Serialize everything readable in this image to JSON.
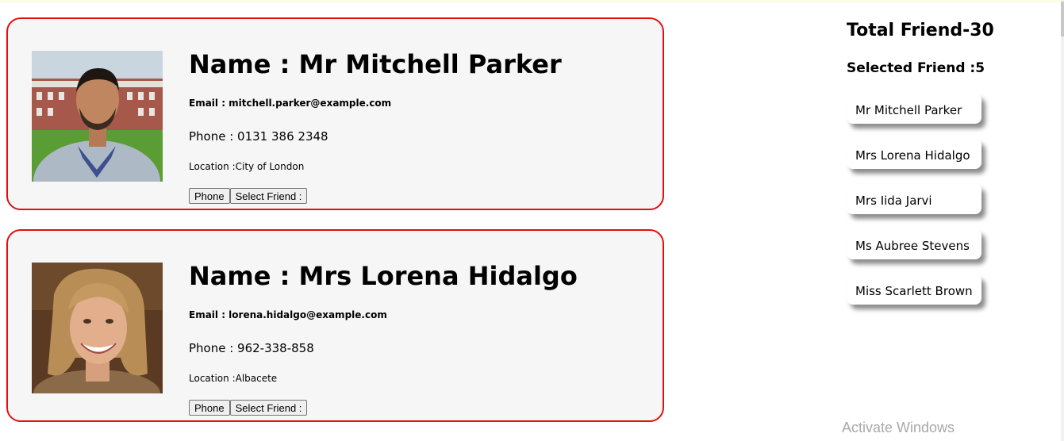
{
  "friends": [
    {
      "name": "Name : Mr Mitchell Parker",
      "email": "Email : mitchell.parker@example.com",
      "phone": "Phone : 0131 386 2348",
      "location": "Location :City of London",
      "phone_button": "Phone",
      "select_button": "Select Friend :"
    },
    {
      "name": "Name : Mrs Lorena Hidalgo",
      "email": "Email : lorena.hidalgo@example.com",
      "phone": "Phone : 962-338-858",
      "location": "Location :Albacete",
      "phone_button": "Phone",
      "select_button": "Select Friend :"
    }
  ],
  "sidebar": {
    "total": "Total Friend-30",
    "selected": "Selected Friend :5",
    "selected_list": [
      "Mr Mitchell Parker",
      "Mrs Lorena Hidalgo",
      "Mrs Iida Jarvi",
      "Ms Aubree Stevens",
      "Miss Scarlett Brown"
    ]
  },
  "watermark": "Activate Windows",
  "colors": {
    "card_border": "#e10f0f",
    "card_background": "#f6f6f6"
  }
}
